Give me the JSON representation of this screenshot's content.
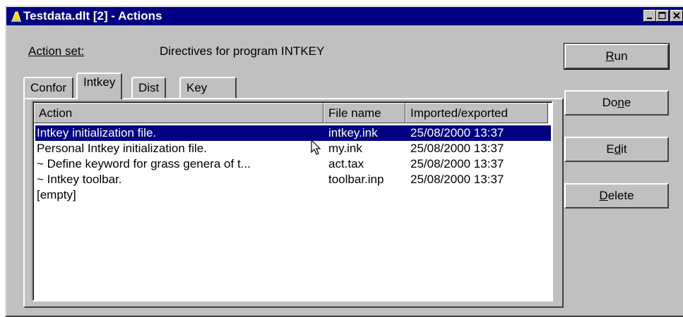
{
  "window": {
    "title": "Testdata.dlt [2] - Actions"
  },
  "action_set": {
    "label": "Action set:",
    "value": "Directives for program INTKEY"
  },
  "tabs": [
    {
      "label": "Confor",
      "active": false
    },
    {
      "label": "Intkey",
      "active": true
    },
    {
      "label": "Dist",
      "active": false
    },
    {
      "label": "Key",
      "active": false
    }
  ],
  "table": {
    "columns": [
      "Action",
      "File name",
      "Imported/exported"
    ],
    "rows": [
      {
        "action": "Intkey initialization file.",
        "file": "intkey.ink",
        "date": "25/08/2000 13:37",
        "selected": true
      },
      {
        "action": "Personal Intkey initialization file.",
        "file": "my.ink",
        "date": "25/08/2000 13:37",
        "selected": false
      },
      {
        "action": "~ Define keyword for grass genera of t...",
        "file": "act.tax",
        "date": "25/08/2000 13:37",
        "selected": false
      },
      {
        "action": "~ Intkey toolbar.",
        "file": "toolbar.inp",
        "date": "25/08/2000 13:37",
        "selected": false
      },
      {
        "action": "[empty]",
        "file": "",
        "date": "",
        "selected": false
      }
    ]
  },
  "buttons": {
    "run": {
      "pre": "",
      "mnemonic": "R",
      "post": "un"
    },
    "done": {
      "pre": "Do",
      "mnemonic": "n",
      "post": "e"
    },
    "edit": {
      "pre": "E",
      "mnemonic": "d",
      "post": "it"
    },
    "delete": {
      "pre": "",
      "mnemonic": "D",
      "post": "elete"
    }
  },
  "colors": {
    "titlebar": "#000080",
    "face": "#c0c0c0",
    "selection": "#000080"
  }
}
